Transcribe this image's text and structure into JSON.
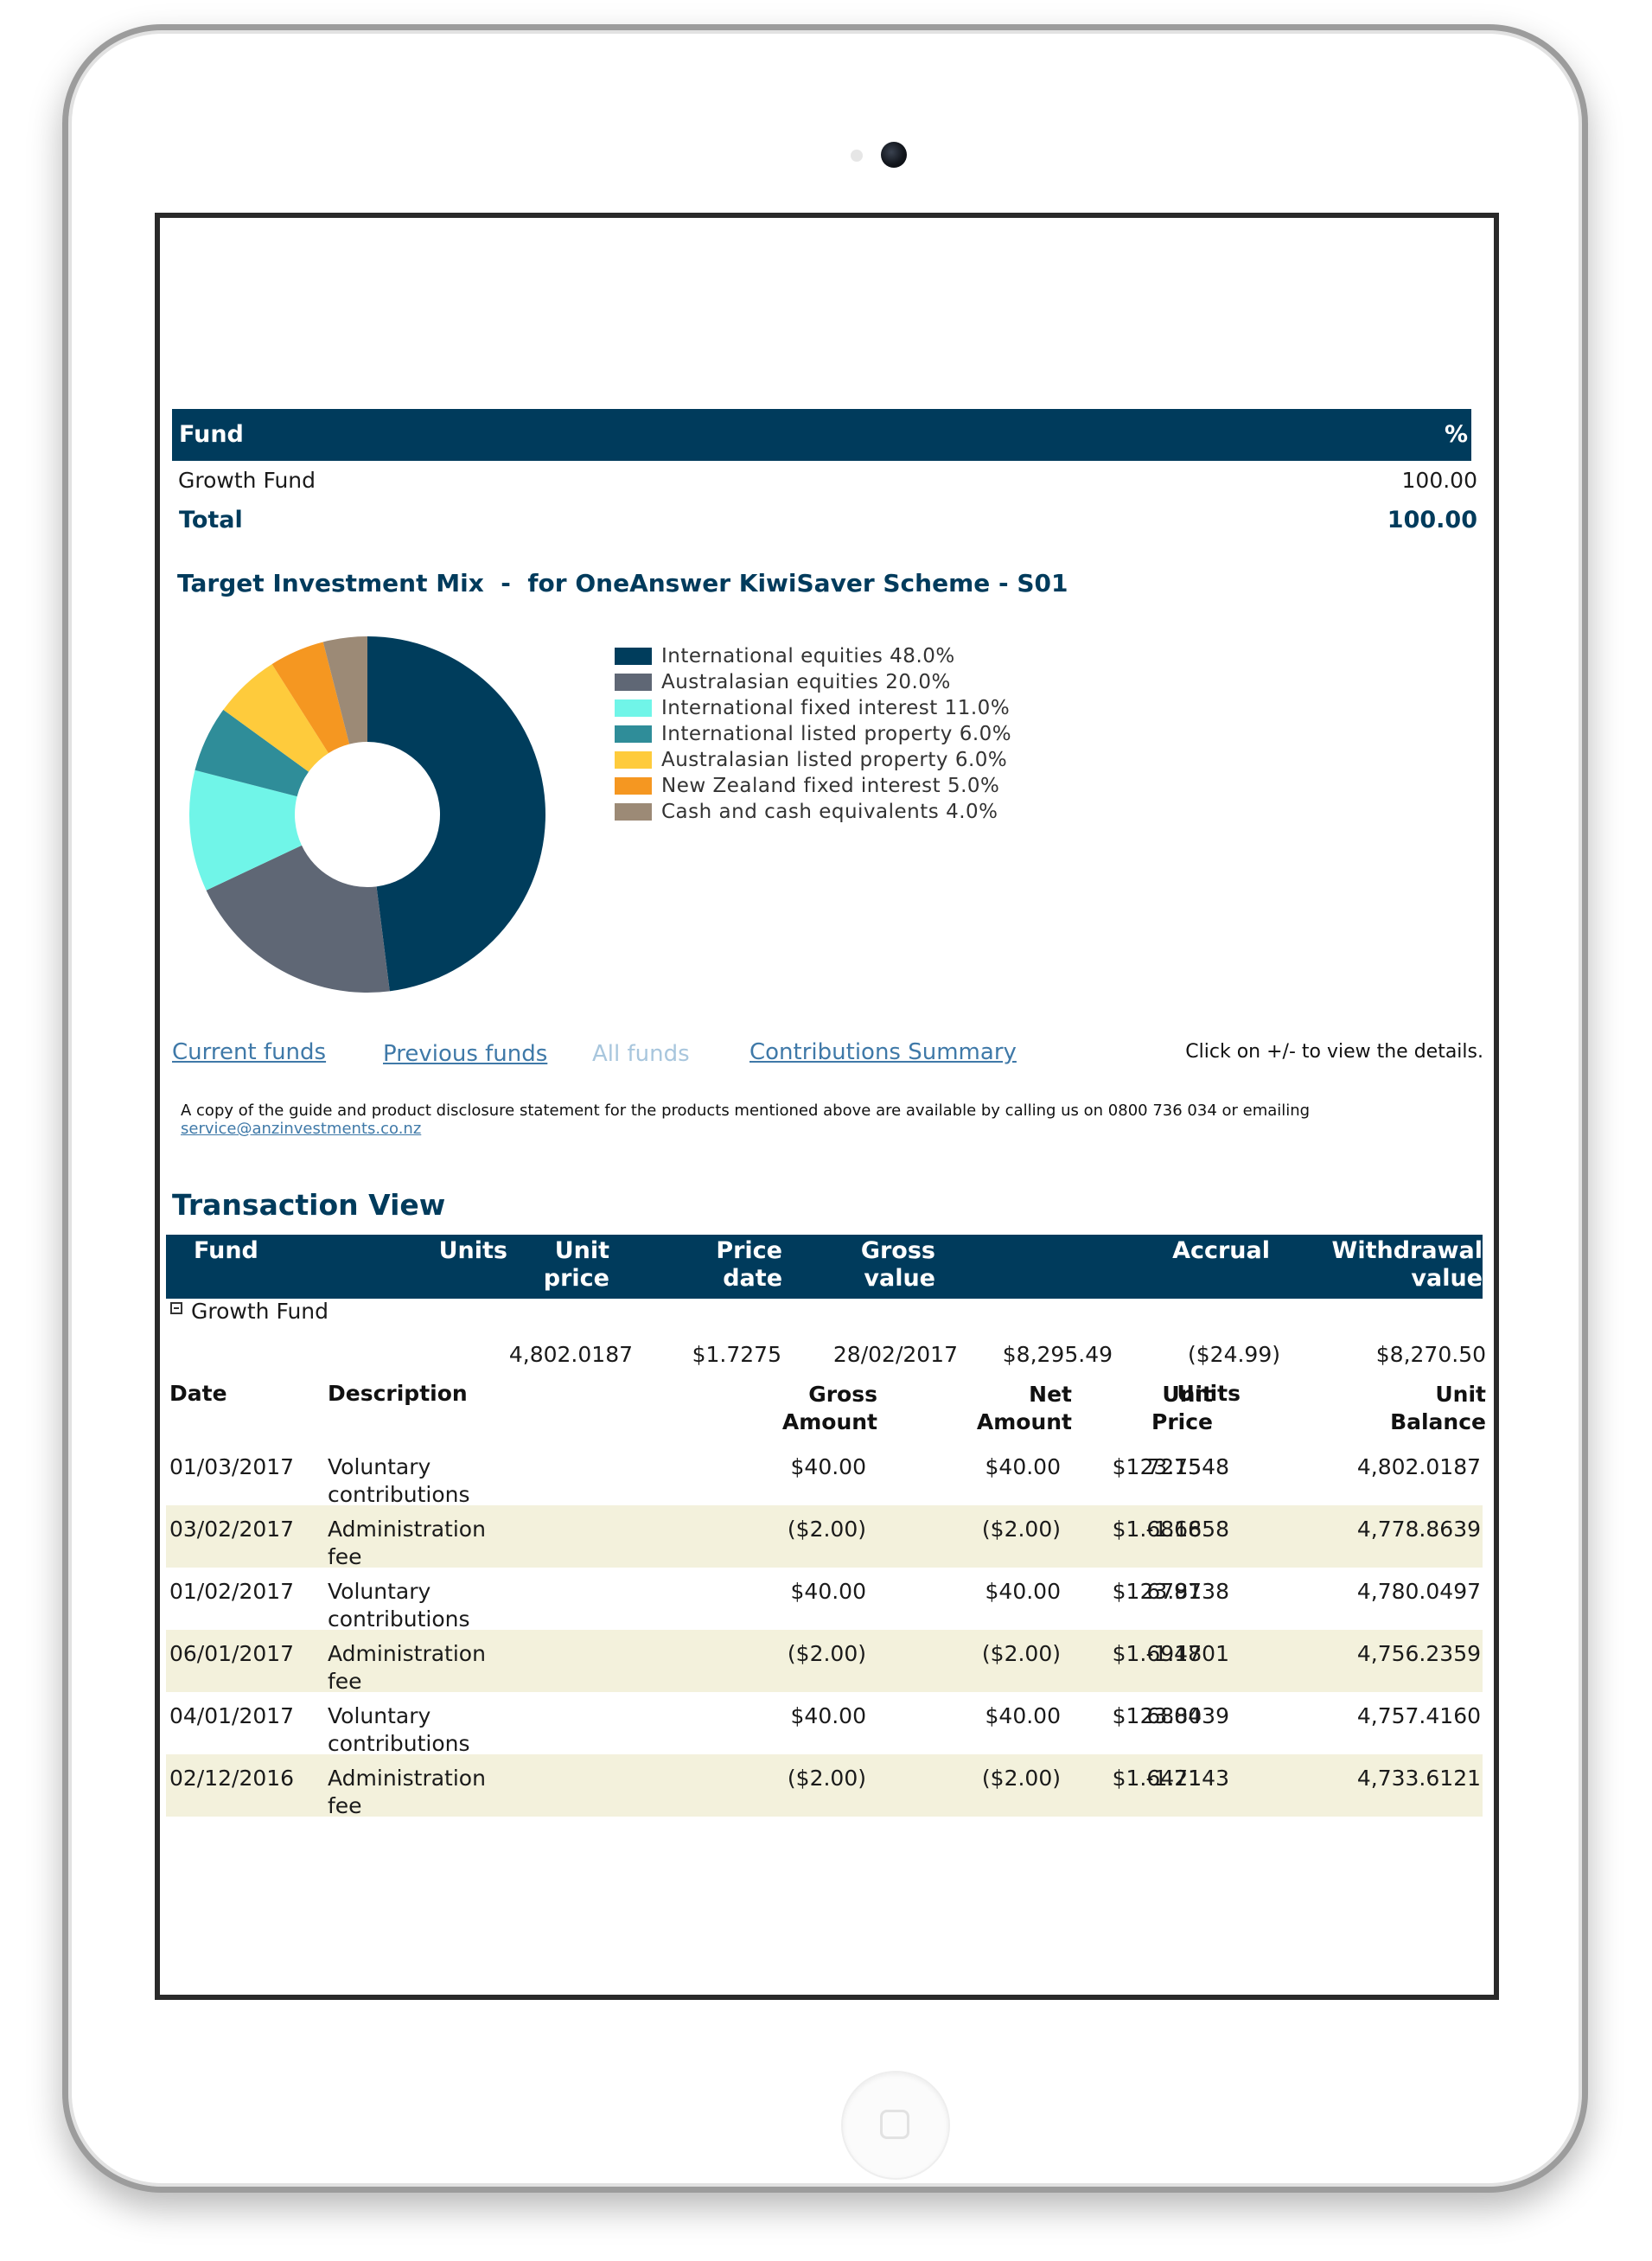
{
  "fund_table": {
    "header_fund": "Fund",
    "header_pct": "%",
    "rows": [
      {
        "name": "Growth Fund",
        "pct": "100.00"
      }
    ],
    "total_label": "Total",
    "total_value": "100.00"
  },
  "mix": {
    "title": "Target Investment Mix  -  for OneAnswer KiwiSaver Scheme - S01"
  },
  "chart_data": {
    "type": "pie",
    "donut": true,
    "categories": [
      "International equities",
      "Australasian equities",
      "International fixed interest",
      "International listed property",
      "Australasian listed property",
      "New Zealand fixed interest",
      "Cash and cash equivalents"
    ],
    "values": [
      48.0,
      20.0,
      11.0,
      6.0,
      6.0,
      5.0,
      4.0
    ],
    "colors": [
      "#003d5c",
      "#5f6775",
      "#70f5e8",
      "#2f8d99",
      "#fecb3c",
      "#f59721",
      "#9c8a76"
    ],
    "legend_labels": [
      "International equities 48.0%",
      "Australasian equities 20.0%",
      "International fixed interest 11.0%",
      "International listed property 6.0%",
      "Australasian listed property 6.0%",
      "New Zealand fixed interest 5.0%",
      "Cash and cash equivalents 4.0%"
    ],
    "legend_position": "right"
  },
  "nav": {
    "current": "Current funds",
    "previous": "Previous funds",
    "all": "All funds",
    "summary": "Contributions Summary",
    "hint": "Click on +/- to view the details."
  },
  "note": {
    "text": "A copy of the guide and product disclosure statement for the products mentioned above are available by calling us on 0800 736 034 or emailing",
    "email": "service@anzinvestments.co.nz"
  },
  "transaction": {
    "title": "Transaction View",
    "headers": {
      "fund": "Fund",
      "units": "Units",
      "unit_price_1": "Unit",
      "unit_price_2": "price",
      "price_date_1": "Price",
      "price_date_2": "date",
      "gross_1": "Gross",
      "gross_2": "value",
      "accrual": "Accrual",
      "withdrawal_1": "Withdrawal",
      "withdrawal_2": "value"
    },
    "fund_name": "Growth Fund",
    "summary": {
      "units": "4,802.0187",
      "unit_price": "$1.7275",
      "price_date": "28/02/2017",
      "gross_value": "$8,295.49",
      "accrual": "($24.99)",
      "withdrawal_value": "$8,270.50"
    },
    "detail_headers": {
      "date": "Date",
      "description": "Description",
      "gross_1": "Gross",
      "gross_2": "Amount",
      "net_1": "Net",
      "net_2": "Amount",
      "unit_price_1": "Unit",
      "unit_price_2": "Price",
      "units": "Units",
      "balance_1": "Unit",
      "balance_2": "Balance"
    },
    "rows": [
      {
        "date": "01/03/2017",
        "desc1": "Voluntary",
        "desc2": "contributions",
        "gross": "$40.00",
        "net": "$40.00",
        "price": "$1.7275",
        "units": "23.1548",
        "balance": "4,802.0187"
      },
      {
        "date": "03/02/2017",
        "desc1": "Administration",
        "desc2": "fee",
        "gross": "($2.00)",
        "net": "($2.00)",
        "price": "$1.6866",
        "units": "-1.1858",
        "balance": "4,778.8639"
      },
      {
        "date": "01/02/2017",
        "desc1": "Voluntary",
        "desc2": "contributions",
        "gross": "$40.00",
        "net": "$40.00",
        "price": "$1.6797",
        "units": "23.8138",
        "balance": "4,780.0497"
      },
      {
        "date": "06/01/2017",
        "desc1": "Administration",
        "desc2": "fee",
        "gross": "($2.00)",
        "net": "($2.00)",
        "price": "$1.6947",
        "units": "-1.1801",
        "balance": "4,756.2359"
      },
      {
        "date": "04/01/2017",
        "desc1": "Voluntary",
        "desc2": "contributions",
        "gross": "$40.00",
        "net": "$40.00",
        "price": "$1.6804",
        "units": "23.8039",
        "balance": "4,757.4160"
      },
      {
        "date": "02/12/2016",
        "desc1": "Administration",
        "desc2": "fee",
        "gross": "($2.00)",
        "net": "($2.00)",
        "price": "$1.6471",
        "units": "-1.2143",
        "balance": "4,733.6121"
      }
    ]
  }
}
